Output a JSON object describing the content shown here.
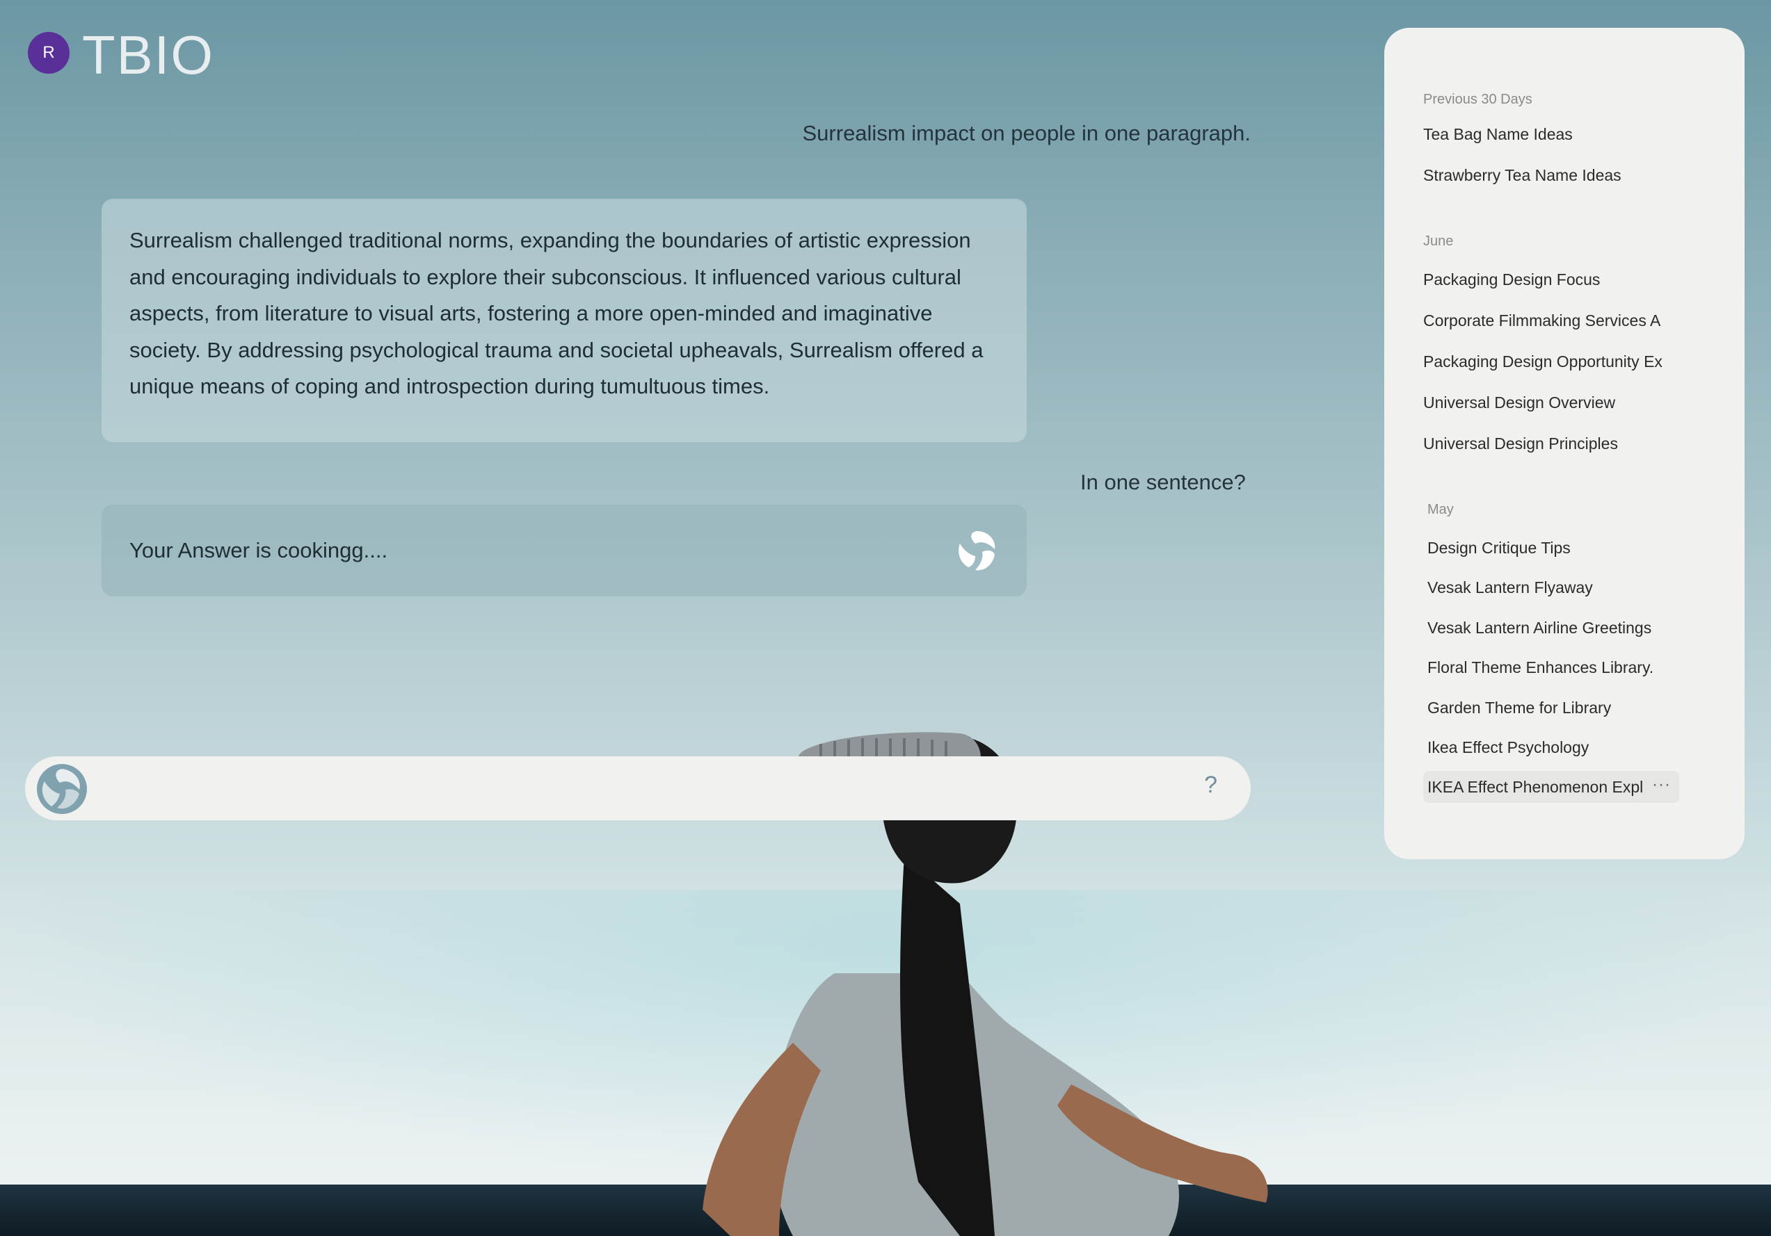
{
  "header": {
    "avatar_initial": "R",
    "brand": "TBIO"
  },
  "chat": {
    "user_message_1": "Surrealism impact on people in one paragraph.",
    "ai_response": "Surrealism challenged traditional norms, expanding the boundaries of artistic expression and encouraging individuals to explore their subconscious. It influenced various cultural aspects, from literature to visual arts, fostering a more open-minded and imaginative society. By addressing psychological trauma and societal upheavals, Surrealism offered a unique means of coping and introspection during tumultuous times.",
    "user_message_2": "In one sentence?",
    "loading_text": "Your Answer is cookingg...."
  },
  "input": {
    "value": "",
    "placeholder": "",
    "help_glyph": "?"
  },
  "sidebar": {
    "groups": [
      {
        "label": "Previous 30 Days",
        "items": [
          "Tea Bag Name Ideas",
          "Strawberry Tea Name Ideas"
        ]
      },
      {
        "label": "June",
        "items": [
          "Packaging Design Focus",
          "Corporate Filmmaking Services A",
          "Packaging Design Opportunity Ex",
          "Universal Design Overview",
          "Universal Design Principles"
        ]
      },
      {
        "label": "May",
        "items": [
          "Design Critique Tips",
          "Vesak Lantern Flyaway",
          "Vesak Lantern Airline Greetings",
          "Floral Theme Enhances Library.",
          "Garden Theme for Library",
          "Ikea Effect Psychology",
          "IKEA Effect Phenomenon Expl"
        ]
      }
    ],
    "more_glyph": "···"
  },
  "colors": {
    "avatar": "#5a2f9a",
    "panel": "#f1f1ef",
    "brand_text": "#e8eef0"
  },
  "icons": {
    "logo": "swirl-logo-icon",
    "spinner": "swirl-spinner-icon",
    "help": "question-icon",
    "more": "more-dots-icon"
  }
}
